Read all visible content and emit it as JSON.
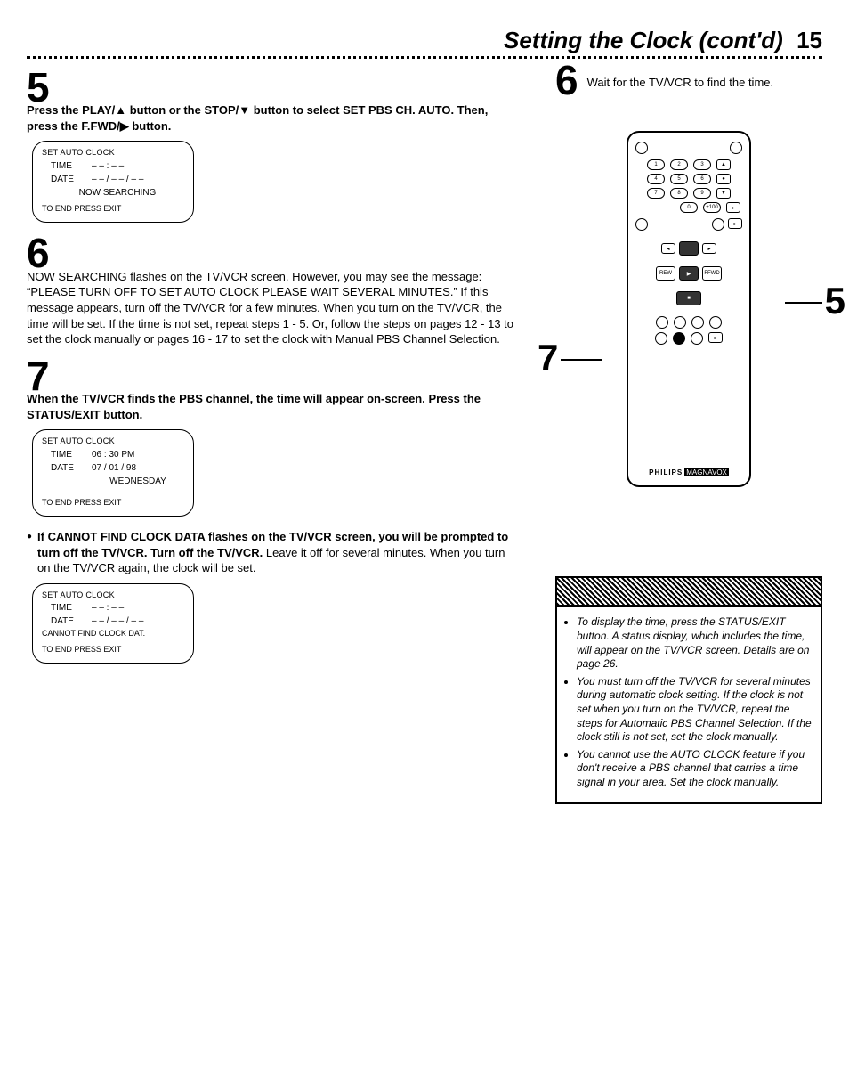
{
  "header": {
    "title": "Setting the Clock (cont'd)",
    "pageNumber": "15"
  },
  "left": {
    "step5": {
      "num": "5",
      "bold1": "Press the PLAY/▲ button or the STOP/▼ button to select SET PBS CH. AUTO. Then, press the F.FWD/▶ button."
    },
    "osd1": {
      "title": "SET AUTO CLOCK",
      "timeLabel": "TIME",
      "timeVal": "– – : – –",
      "dateLabel": "DATE",
      "dateVal": "– – / – – / – –",
      "line3": "NOW SEARCHING",
      "footer": "TO END PRESS EXIT"
    },
    "step6": {
      "num": "6",
      "body": "NOW SEARCHING flashes on the TV/VCR screen. However, you may see the message: “PLEASE TURN OFF TO SET AUTO CLOCK PLEASE WAIT SEVERAL MINUTES.” If this message appears, turn off the TV/VCR for a few minutes. When you turn on the TV/VCR, the time will be set. If the time is not set, repeat steps 1 - 5. Or, follow the steps on pages 12 - 13 to set the clock manually or pages 16 - 17 to set the clock with Manual PBS Channel Selection."
    },
    "step7": {
      "num": "7",
      "bold1": "When the TV/VCR finds the PBS channel, the time will appear on-screen. Press the STATUS/EXIT button."
    },
    "osd2": {
      "title": "SET AUTO CLOCK",
      "timeLabel": "TIME",
      "timeVal": "06 : 30 PM",
      "dateLabel": "DATE",
      "dateVal": "07 / 01 / 98",
      "line3": "WEDNESDAY",
      "footer": "TO END PRESS EXIT"
    },
    "cannot": {
      "bold": "If CANNOT FIND CLOCK DATA flashes on the TV/VCR screen, you will be prompted to turn off the TV/VCR. Turn off the TV/VCR.",
      "tail": " Leave it off for several minutes. When you turn on the TV/VCR again, the clock will be set."
    },
    "osd3": {
      "title": "SET AUTO CLOCK",
      "timeLabel": "TIME",
      "timeVal": "– – : – –",
      "dateLabel": "DATE",
      "dateVal": "– – / – – / – –",
      "line3": "CANNOT FIND CLOCK DAT.",
      "footer": "TO END PRESS EXIT"
    }
  },
  "right": {
    "step6num": "6",
    "step6text": "Wait for the TV/VCR to find the time.",
    "callout5": "5",
    "callout7": "7",
    "remoteBrand1": "PHILIPS",
    "remoteBrand2": "MAGNAVOX"
  },
  "tips": {
    "items": [
      "To display the time, press the STATUS/EXIT button. A status display, which includes the time, will appear on the TV/VCR screen. Details are on page 26.",
      "You must turn off the TV/VCR for several minutes during automatic clock setting. If the clock is not set when you turn on the TV/VCR, repeat the steps for Automatic PBS Channel Selection. If the clock still is not set, set the clock manually.",
      "You cannot use the AUTO CLOCK feature if you don't receive a PBS channel that carries a time signal in your area. Set the clock manually."
    ]
  }
}
